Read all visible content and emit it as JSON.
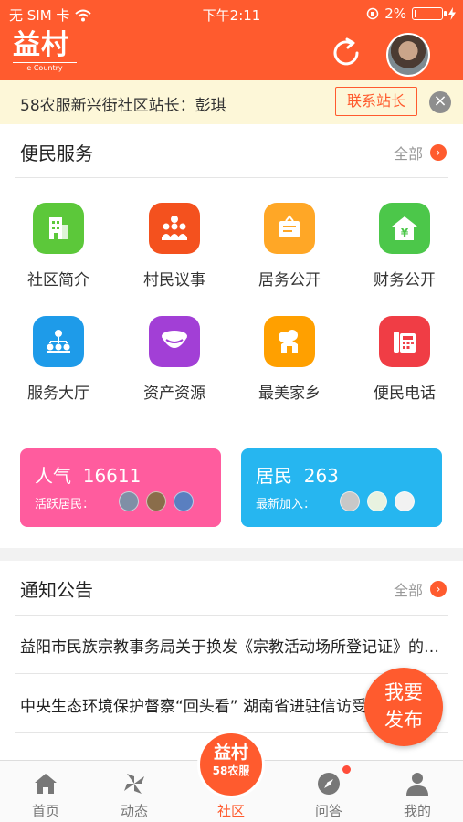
{
  "status_bar": {
    "carrier": "无 SIM 卡",
    "time": "下午2:11",
    "battery": "2%",
    "battery_fraction": 0.02
  },
  "header": {
    "logo_text": "益村",
    "logo_subtext": "e Country",
    "refresh_icon": "refresh-icon",
    "avatar": "user-avatar"
  },
  "notice": {
    "text": "58农服新兴街社区站长：彭琪",
    "contact_label": "联系站长",
    "close_icon": "close-icon"
  },
  "services": {
    "title": "便民服务",
    "more_label": "全部",
    "items": [
      {
        "label": "社区简介",
        "icon": "building-icon",
        "color": "#5cc83a"
      },
      {
        "label": "村民议事",
        "icon": "meeting-icon",
        "color": "#f4511e"
      },
      {
        "label": "居务公开",
        "icon": "notice-board-icon",
        "color": "#ffa726"
      },
      {
        "label": "财务公开",
        "icon": "finance-house-icon",
        "color": "#4cc74a"
      },
      {
        "label": "服务大厅",
        "icon": "org-chart-icon",
        "color": "#1e9be9"
      },
      {
        "label": "资产资源",
        "icon": "bowl-icon",
        "color": "#a23fd6"
      },
      {
        "label": "最美家乡",
        "icon": "hometown-icon",
        "color": "#ffa000"
      },
      {
        "label": "便民电话",
        "icon": "telephone-icon",
        "color": "#f03d45"
      }
    ]
  },
  "stats": {
    "popularity": {
      "label": "人气",
      "value": "16611",
      "sub_label": "活跃居民：",
      "color": "#ff5c9e"
    },
    "residents": {
      "label": "居民",
      "value": "263",
      "sub_label": "最新加入：",
      "color": "#26b6f0"
    }
  },
  "announcements": {
    "title": "通知公告",
    "more_label": "全部",
    "items": [
      "益阳市民族宗教事务局关于换发《宗教活动场所登记证》的通知",
      "中央生态环境保护督察“回头看” 湖南省进驻信访受理"
    ]
  },
  "fab": {
    "line1": "我要",
    "line2": "发布"
  },
  "tabbar": {
    "home": "首页",
    "feed": "动态",
    "community": "社区",
    "qa": "问答",
    "mine": "我的",
    "center_line1": "益村",
    "center_line2": "58农服"
  }
}
